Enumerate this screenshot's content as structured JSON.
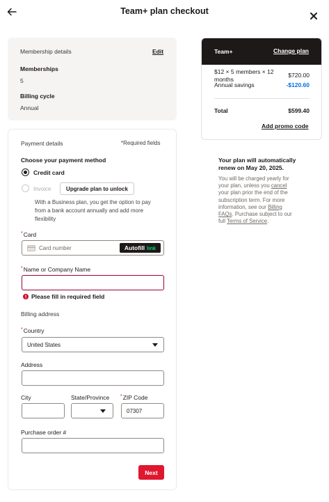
{
  "header": {
    "title": "Team+ plan checkout"
  },
  "membership": {
    "section_label": "Membership details",
    "edit_label": "Edit",
    "memberships_label": "Memberships",
    "memberships_value": "5",
    "billing_cycle_label": "Billing cycle",
    "billing_cycle_value": "Annual"
  },
  "payment": {
    "section_label": "Payment details",
    "required_note": "*Required fields",
    "method_label": "Choose your payment method",
    "credit_card_label": "Credit card",
    "invoice_label": "Invoice",
    "upgrade_button": "Upgrade plan to unlock",
    "business_note_lines": [
      "With a Business plan, you get the option to pay",
      "from a bank account annually and add more",
      "flexibility"
    ],
    "card_label": "Card",
    "card_placeholder": "Card number",
    "autofill_label": "Autofill",
    "autofill_link": "link",
    "name_label": "Name or Company Name",
    "name_value": "",
    "error_text": "Please fill in required field",
    "billing_address_label": "Billing address",
    "country_label": "Country",
    "country_value": "United States",
    "address_label": "Address",
    "city_label": "City",
    "state_label": "State/Province",
    "zip_label": "ZIP Code",
    "zip_value": "07307",
    "po_label": "Purchase order #",
    "next_button": "Next"
  },
  "summary": {
    "plan_name": "Team+",
    "change_plan": "Change plan",
    "line_item_line1": "$12 × 5 members × 12",
    "line_item_line2": "months",
    "line_item_amount": "$720.00",
    "savings_label": "Annual savings",
    "savings_amount": "-$120.60",
    "total_label": "Total",
    "total_amount": "$599.40",
    "promo_link": "Add promo code"
  },
  "renewal": {
    "title_line1": "Your plan will automatically",
    "title_line2": "renew on May 20, 2025.",
    "body_l1": "You will be charged yearly for",
    "body_l2_pre": "your plan, unless you ",
    "body_l2_link": "cancel",
    "body_l3": "your plan prior the end of the",
    "body_l4": "subscription term. For more",
    "body_l5_pre": "information, see our ",
    "body_l5_link": "Billing",
    "body_l6_link": "FAQs",
    "body_l6_post": ". Purchase subject to our",
    "body_l7_pre": "full ",
    "body_l7_link": "Terms of Service",
    "body_l7_post": "."
  },
  "colors": {
    "primary_button": "#e0182f",
    "error": "#9b0032",
    "savings": "#0070e0",
    "summary_header": "#1e1919",
    "autofill_bg": "#1e1919",
    "autofill_link": "#00d66f"
  },
  "icons": [
    "back-arrow-icon",
    "close-icon",
    "card-icon",
    "error-icon",
    "chevron-down-icon"
  ]
}
